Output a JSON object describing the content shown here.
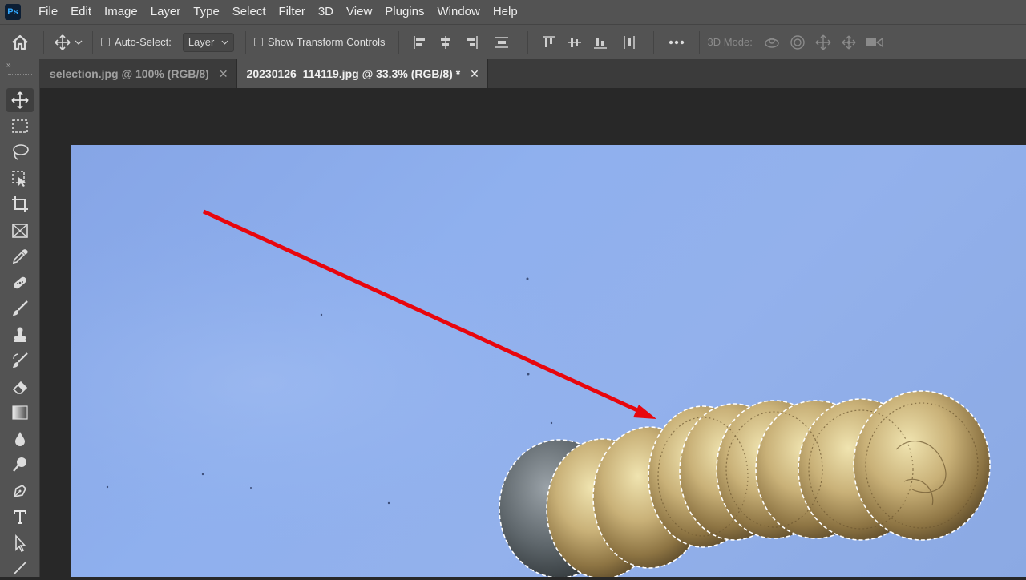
{
  "menubar": {
    "logo": "Ps",
    "items": [
      "File",
      "Edit",
      "Image",
      "Layer",
      "Type",
      "Select",
      "Filter",
      "3D",
      "View",
      "Plugins",
      "Window",
      "Help"
    ]
  },
  "options": {
    "auto_select_label": "Auto-Select:",
    "layer_dropdown": "Layer",
    "show_transform_label": "Show Transform Controls",
    "three_d_mode_label": "3D Mode:"
  },
  "tabs": [
    {
      "label": "selection.jpg @ 100% (RGB/8)",
      "active": false
    },
    {
      "label": "20230126_114119.jpg @ 33.3% (RGB/8) *",
      "active": true
    }
  ],
  "tools": [
    "move-tool",
    "marquee-tool",
    "lasso-tool",
    "object-selection-tool",
    "crop-tool",
    "frame-tool",
    "eyedropper-tool",
    "healing-brush-tool",
    "brush-tool",
    "clone-stamp-tool",
    "history-brush-tool",
    "eraser-tool",
    "gradient-tool",
    "blur-tool",
    "dodge-tool",
    "pen-tool",
    "type-tool",
    "path-selection-tool",
    "line-tool"
  ],
  "colors": {
    "arrow": "#e8060d",
    "canvas_bg": "#8fb0ee",
    "panel": "#535353"
  }
}
